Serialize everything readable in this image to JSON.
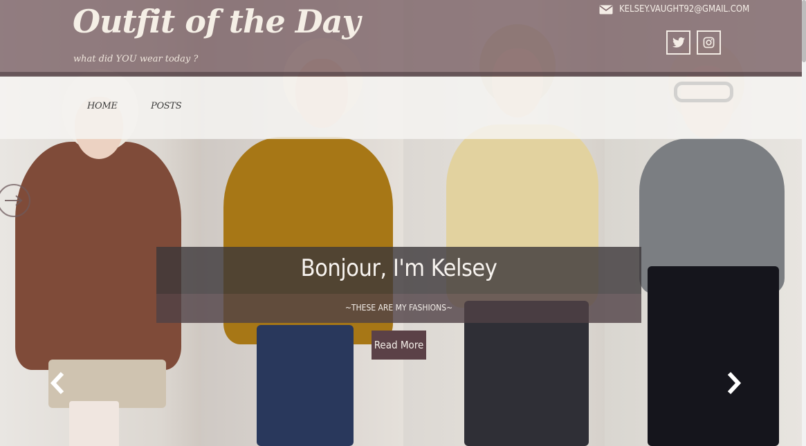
{
  "site": {
    "title": "Outfit of the Day",
    "tagline": "what did YOU wear today ?",
    "email": "kelsey.vaught92@gmail.com"
  },
  "social": [
    {
      "name": "twitter",
      "icon": "twitter-icon"
    },
    {
      "name": "instagram",
      "icon": "instagram-icon"
    }
  ],
  "nav": {
    "items": [
      {
        "label": "Home"
      },
      {
        "label": "Posts"
      }
    ]
  },
  "hero": {
    "title": "Bonjour, I'm Kelsey",
    "subtitle": "~these are my fashions~",
    "button_label": "Read More",
    "slide_count_visible_panels": 4
  },
  "colors": {
    "header_overlay": "#785f64",
    "nav_overlay": "#f6f4f2",
    "caption_overlay": "#3c373a",
    "button_bg": "#5b4147",
    "text_light": "#f7f3ef"
  },
  "icons": {
    "mail": "mail-icon",
    "prev": "chevron-left-icon",
    "next": "chevron-right-icon",
    "side": "circle-arrow-right-icon"
  }
}
